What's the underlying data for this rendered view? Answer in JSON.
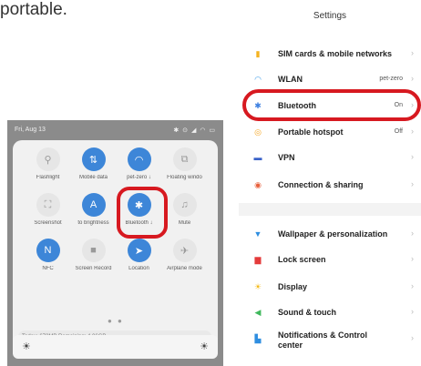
{
  "caption": "portable.",
  "control_center": {
    "status_time": "Fri, Aug 13",
    "status_icons": "✱ ⊙ ◢ ◠ ▭",
    "tiles": [
      {
        "label": "Flashlight",
        "icon": "flashlight-icon",
        "glyph": "⚲",
        "on": false
      },
      {
        "label": "Mobile data",
        "icon": "mobile-data-icon",
        "glyph": "⇅",
        "on": true
      },
      {
        "label": "pet-zero ↓",
        "icon": "wifi-icon",
        "glyph": "◠",
        "on": true
      },
      {
        "label": "Floating windo",
        "icon": "floating-window-icon",
        "glyph": "⧉",
        "on": false
      },
      {
        "label": "Screenshot",
        "icon": "screenshot-icon",
        "glyph": "⛶",
        "on": false
      },
      {
        "label": "to brightness",
        "icon": "auto-brightness-icon",
        "glyph": "A",
        "on": true
      },
      {
        "label": "Bluetooth ↓",
        "icon": "bluetooth-icon",
        "glyph": "✱",
        "on": true
      },
      {
        "label": "Mute",
        "icon": "mute-icon",
        "glyph": "♫",
        "on": false
      },
      {
        "label": "NFC",
        "icon": "nfc-icon",
        "glyph": "N",
        "on": true
      },
      {
        "label": "Screen Record",
        "icon": "screen-record-icon",
        "glyph": "■",
        "on": false
      },
      {
        "label": "Location",
        "icon": "location-icon",
        "glyph": "➤",
        "on": true
      },
      {
        "label": "Airplane mode",
        "icon": "airplane-icon",
        "glyph": "✈",
        "on": false
      }
    ],
    "page_dots": "● ●",
    "storage_text": "Today: 672MB   Remaining: 4.06GB",
    "brightness_left_icon": "☀",
    "brightness_right_icon": "☀"
  },
  "settings": {
    "title": "Settings",
    "rows": [
      {
        "label": "SIM cards & mobile networks",
        "value": "",
        "icon": "sim-icon",
        "color": "#f5b320",
        "glyph": "▮"
      },
      {
        "label": "WLAN",
        "value": "pet-zero",
        "icon": "wifi-icon",
        "color": "#3c9be8",
        "glyph": "◠"
      },
      {
        "label": "Bluetooth",
        "value": "On",
        "icon": "bluetooth-icon",
        "color": "#3c7fe0",
        "glyph": "✱"
      },
      {
        "label": "Portable hotspot",
        "value": "Off",
        "icon": "hotspot-icon",
        "color": "#f5a623",
        "glyph": "◎"
      },
      {
        "label": "VPN",
        "value": "",
        "icon": "vpn-icon",
        "color": "#3a62c9",
        "glyph": "▬"
      },
      {
        "label": "Connection & sharing",
        "value": "",
        "icon": "connection-sharing-icon",
        "color": "#e8603c",
        "glyph": "◉"
      },
      {
        "label": "Wallpaper & personalization",
        "value": "",
        "icon": "wallpaper-icon",
        "color": "#2f8ee0",
        "glyph": "▼"
      },
      {
        "label": "Lock screen",
        "value": "",
        "icon": "lock-icon",
        "color": "#e43b3b",
        "glyph": "▆"
      },
      {
        "label": "Display",
        "value": "",
        "icon": "display-icon",
        "color": "#f4b915",
        "glyph": "☀"
      },
      {
        "label": "Sound & touch",
        "value": "",
        "icon": "sound-icon",
        "color": "#3fb85c",
        "glyph": "◀"
      },
      {
        "label": "Notifications & Control center",
        "value": "",
        "icon": "notifications-icon",
        "color": "#2f8ee0",
        "glyph": "▙"
      }
    ]
  },
  "highlight_color": "#d71920"
}
